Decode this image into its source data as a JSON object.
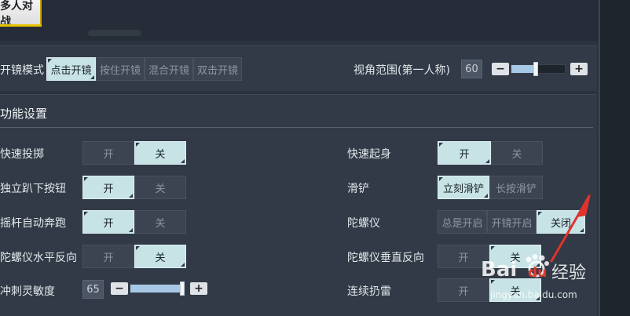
{
  "header": {
    "active_tab": "多人对战"
  },
  "scope": {
    "label": "开镜模式",
    "options": [
      "点击开镜",
      "按住开镜",
      "混合开镜",
      "双击开镜"
    ],
    "selected_index": 0
  },
  "fov": {
    "label": "视角范围(第一人称)",
    "value": "60",
    "level": 0.45
  },
  "section": {
    "title": "功能设置"
  },
  "settings_left": [
    {
      "label": "快速投掷",
      "options": [
        "开",
        "关"
      ],
      "selected_index": 1
    },
    {
      "label": "独立趴下按钮",
      "options": [
        "开",
        "关"
      ],
      "selected_index": 0
    },
    {
      "label": "摇杆自动奔跑",
      "options": [
        "开",
        "关"
      ],
      "selected_index": 0
    },
    {
      "label": "陀螺仪水平反向",
      "options": [
        "开",
        "关"
      ],
      "selected_index": 1
    }
  ],
  "settings_right": [
    {
      "label": "快速起身",
      "options": [
        "开",
        "关"
      ],
      "selected_index": 0
    },
    {
      "label": "滑铲",
      "options": [
        "立刻滑铲",
        "长按滑铲"
      ],
      "selected_index": 0
    },
    {
      "label": "陀螺仪",
      "options": [
        "总是开启",
        "开镜开启",
        "关闭"
      ],
      "selected_index": 2
    },
    {
      "label": "陀螺仪垂直反向",
      "options": [
        "开",
        "关"
      ],
      "selected_index": 1
    },
    {
      "label": "连续扔雷",
      "options": [
        "开",
        "关"
      ],
      "selected_index": 1
    }
  ],
  "sprint_sensitivity": {
    "label": "冲刺灵敏度",
    "value": "65",
    "level": 0.95
  },
  "watermark": {
    "brand_a": "Bai",
    "brand_b": "du",
    "brand_c": "经验",
    "url": "jingyan.baidu.com"
  },
  "colors": {
    "background": "#2b333f",
    "panel": "#313a46",
    "active_option": "#c7e3e6",
    "inactive_option": "#3b4450",
    "tab_highlight": "#e6c200",
    "annotation_arrow": "#e0322d",
    "slider_fill": "#a7c9e6"
  }
}
